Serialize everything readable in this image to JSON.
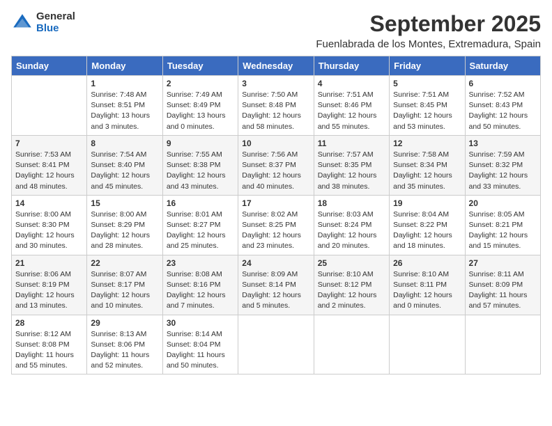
{
  "logo": {
    "general": "General",
    "blue": "Blue"
  },
  "title": "September 2025",
  "subtitle": "Fuenlabrada de los Montes, Extremadura, Spain",
  "weekdays": [
    "Sunday",
    "Monday",
    "Tuesday",
    "Wednesday",
    "Thursday",
    "Friday",
    "Saturday"
  ],
  "weeks": [
    [
      {
        "day": "",
        "content": ""
      },
      {
        "day": "1",
        "content": "Sunrise: 7:48 AM\nSunset: 8:51 PM\nDaylight: 13 hours\nand 3 minutes."
      },
      {
        "day": "2",
        "content": "Sunrise: 7:49 AM\nSunset: 8:49 PM\nDaylight: 13 hours\nand 0 minutes."
      },
      {
        "day": "3",
        "content": "Sunrise: 7:50 AM\nSunset: 8:48 PM\nDaylight: 12 hours\nand 58 minutes."
      },
      {
        "day": "4",
        "content": "Sunrise: 7:51 AM\nSunset: 8:46 PM\nDaylight: 12 hours\nand 55 minutes."
      },
      {
        "day": "5",
        "content": "Sunrise: 7:51 AM\nSunset: 8:45 PM\nDaylight: 12 hours\nand 53 minutes."
      },
      {
        "day": "6",
        "content": "Sunrise: 7:52 AM\nSunset: 8:43 PM\nDaylight: 12 hours\nand 50 minutes."
      }
    ],
    [
      {
        "day": "7",
        "content": "Sunrise: 7:53 AM\nSunset: 8:41 PM\nDaylight: 12 hours\nand 48 minutes."
      },
      {
        "day": "8",
        "content": "Sunrise: 7:54 AM\nSunset: 8:40 PM\nDaylight: 12 hours\nand 45 minutes."
      },
      {
        "day": "9",
        "content": "Sunrise: 7:55 AM\nSunset: 8:38 PM\nDaylight: 12 hours\nand 43 minutes."
      },
      {
        "day": "10",
        "content": "Sunrise: 7:56 AM\nSunset: 8:37 PM\nDaylight: 12 hours\nand 40 minutes."
      },
      {
        "day": "11",
        "content": "Sunrise: 7:57 AM\nSunset: 8:35 PM\nDaylight: 12 hours\nand 38 minutes."
      },
      {
        "day": "12",
        "content": "Sunrise: 7:58 AM\nSunset: 8:34 PM\nDaylight: 12 hours\nand 35 minutes."
      },
      {
        "day": "13",
        "content": "Sunrise: 7:59 AM\nSunset: 8:32 PM\nDaylight: 12 hours\nand 33 minutes."
      }
    ],
    [
      {
        "day": "14",
        "content": "Sunrise: 8:00 AM\nSunset: 8:30 PM\nDaylight: 12 hours\nand 30 minutes."
      },
      {
        "day": "15",
        "content": "Sunrise: 8:00 AM\nSunset: 8:29 PM\nDaylight: 12 hours\nand 28 minutes."
      },
      {
        "day": "16",
        "content": "Sunrise: 8:01 AM\nSunset: 8:27 PM\nDaylight: 12 hours\nand 25 minutes."
      },
      {
        "day": "17",
        "content": "Sunrise: 8:02 AM\nSunset: 8:25 PM\nDaylight: 12 hours\nand 23 minutes."
      },
      {
        "day": "18",
        "content": "Sunrise: 8:03 AM\nSunset: 8:24 PM\nDaylight: 12 hours\nand 20 minutes."
      },
      {
        "day": "19",
        "content": "Sunrise: 8:04 AM\nSunset: 8:22 PM\nDaylight: 12 hours\nand 18 minutes."
      },
      {
        "day": "20",
        "content": "Sunrise: 8:05 AM\nSunset: 8:21 PM\nDaylight: 12 hours\nand 15 minutes."
      }
    ],
    [
      {
        "day": "21",
        "content": "Sunrise: 8:06 AM\nSunset: 8:19 PM\nDaylight: 12 hours\nand 13 minutes."
      },
      {
        "day": "22",
        "content": "Sunrise: 8:07 AM\nSunset: 8:17 PM\nDaylight: 12 hours\nand 10 minutes."
      },
      {
        "day": "23",
        "content": "Sunrise: 8:08 AM\nSunset: 8:16 PM\nDaylight: 12 hours\nand 7 minutes."
      },
      {
        "day": "24",
        "content": "Sunrise: 8:09 AM\nSunset: 8:14 PM\nDaylight: 12 hours\nand 5 minutes."
      },
      {
        "day": "25",
        "content": "Sunrise: 8:10 AM\nSunset: 8:12 PM\nDaylight: 12 hours\nand 2 minutes."
      },
      {
        "day": "26",
        "content": "Sunrise: 8:10 AM\nSunset: 8:11 PM\nDaylight: 12 hours\nand 0 minutes."
      },
      {
        "day": "27",
        "content": "Sunrise: 8:11 AM\nSunset: 8:09 PM\nDaylight: 11 hours\nand 57 minutes."
      }
    ],
    [
      {
        "day": "28",
        "content": "Sunrise: 8:12 AM\nSunset: 8:08 PM\nDaylight: 11 hours\nand 55 minutes."
      },
      {
        "day": "29",
        "content": "Sunrise: 8:13 AM\nSunset: 8:06 PM\nDaylight: 11 hours\nand 52 minutes."
      },
      {
        "day": "30",
        "content": "Sunrise: 8:14 AM\nSunset: 8:04 PM\nDaylight: 11 hours\nand 50 minutes."
      },
      {
        "day": "",
        "content": ""
      },
      {
        "day": "",
        "content": ""
      },
      {
        "day": "",
        "content": ""
      },
      {
        "day": "",
        "content": ""
      }
    ]
  ]
}
